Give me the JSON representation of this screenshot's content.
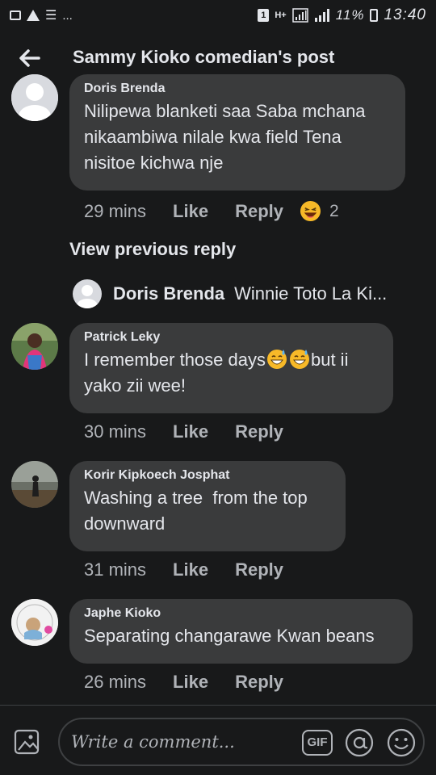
{
  "status_bar": {
    "left_icons": [
      "image-icon",
      "warning-icon",
      "list-icon"
    ],
    "dots": "...",
    "sim": "1",
    "network": "H+",
    "battery_pct": "11%",
    "time": "13:40"
  },
  "header": {
    "title": "Sammy Kioko comedian's post",
    "back_icon": "back-arrow-icon"
  },
  "comments": [
    {
      "name": "Doris Brenda",
      "lines": [
        "Nilipewa blanketi saa Saba mchana",
        "nikaambiwa nilale kwa field Tena",
        "nisitoe kichwa nje"
      ],
      "time": "29 mins",
      "like": "Like",
      "reply": "Reply",
      "reaction": "haha",
      "reaction_count": "2"
    },
    {
      "name": "Patrick Leky",
      "line1_text": "I remember those days",
      "line1_suffix": "but ii",
      "line2": "yako zii wee!",
      "time": "30 mins",
      "like": "Like",
      "reply": "Reply"
    },
    {
      "name": "Korir Kipkoech Josphat",
      "lines": [
        "Washing a tree  from the top",
        "downward"
      ],
      "time": "31 mins",
      "like": "Like",
      "reply": "Reply"
    },
    {
      "name": "Japhe Kioko",
      "lines": [
        "Separating changarawe Kwan beans"
      ],
      "time": "26 mins",
      "like": "Like",
      "reply": "Reply"
    }
  ],
  "view_previous_reply": "View previous reply",
  "reply_preview": {
    "name": "Doris Brenda",
    "text": "Winnie Toto La Ki..."
  },
  "composer": {
    "placeholder": "Write a comment...",
    "gif_label": "GIF",
    "icons": [
      "photo-icon",
      "gif-icon",
      "at-icon",
      "emoji-icon"
    ]
  },
  "colors": {
    "background": "#18191a",
    "bubble": "#3a3b3c",
    "text": "#e4e6eb",
    "secondary_text": "#b0b3b8"
  }
}
